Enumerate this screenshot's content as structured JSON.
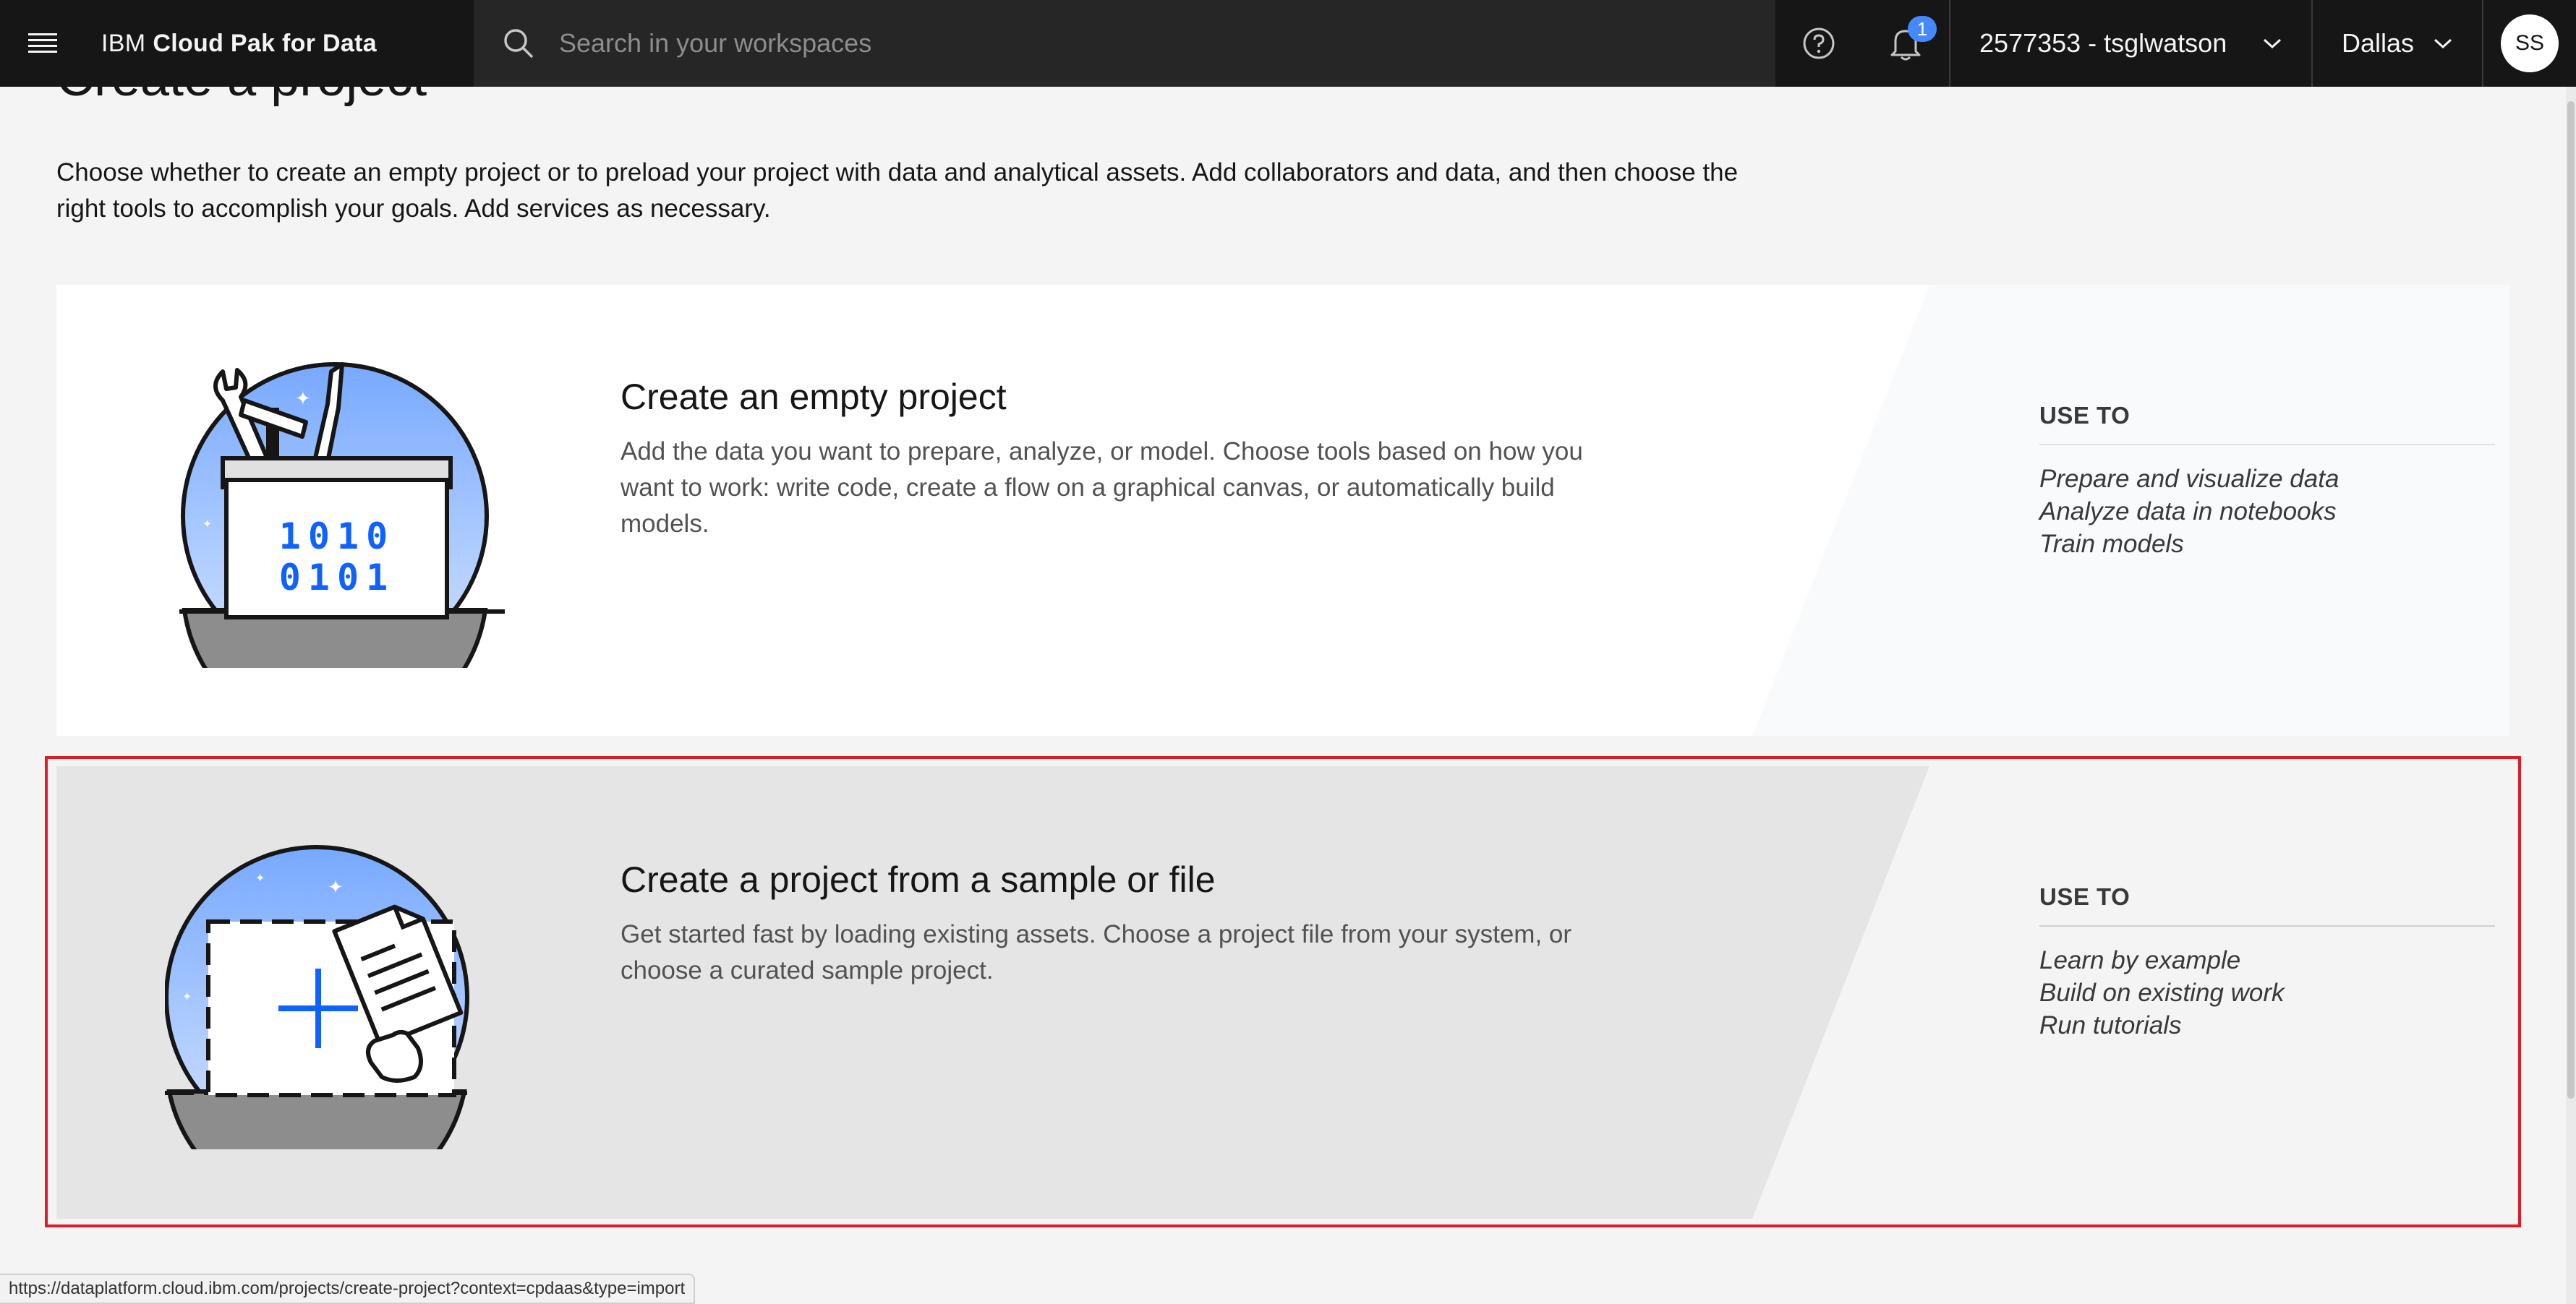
{
  "header": {
    "brand_prefix": "IBM",
    "brand_name": "Cloud Pak for Data",
    "search_placeholder": "Search in your workspaces",
    "notification_count": "1",
    "account": "2577353 - tsglwatson",
    "region": "Dallas",
    "avatar_initials": "SS"
  },
  "page": {
    "title": "Create a project",
    "intro": "Choose whether to create an empty project or to preload your project with data and analytical assets. Add collaborators and data, and then choose the right tools to accomplish your goals. Add services as necessary."
  },
  "tiles": [
    {
      "heading": "Create an empty project",
      "description": "Add the data you want to prepare, analyze, or model. Choose tools based on how you want to work: write code, create a flow on a graphical canvas, or automatically build models.",
      "use_to_title": "USE TO",
      "use_to": [
        "Prepare and visualize data",
        "Analyze data in notebooks",
        "Train models"
      ],
      "illustration_text": [
        "1010",
        "0101"
      ]
    },
    {
      "heading": "Create a project from a sample or file",
      "description": "Get started fast by loading existing assets. Choose a project file from your system, or choose a curated sample project.",
      "use_to_title": "USE TO",
      "use_to": [
        "Learn by example",
        "Build on existing work",
        "Run tutorials"
      ]
    }
  ],
  "status_url": "https://dataplatform.cloud.ibm.com/projects/create-project?context=cpdaas&type=import",
  "colors": {
    "header_bg": "#161616",
    "search_bg": "#262626",
    "badge": "#4589ff",
    "highlight": "#da1e28",
    "illustration_blue": "#0f62fe"
  }
}
